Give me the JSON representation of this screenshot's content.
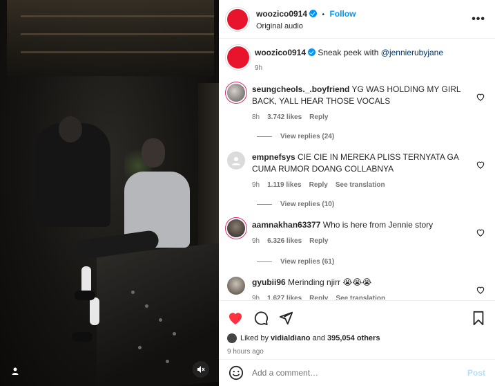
{
  "media": {
    "icons": {
      "user_tag": "person-icon",
      "mute": "speaker-muted-icon"
    }
  },
  "header": {
    "username": "woozico0914",
    "follow_label": "Follow",
    "dot": "•",
    "subtitle": "Original audio",
    "more": "•••",
    "avatar_color": "#e8142e"
  },
  "caption": {
    "username": "woozico0914",
    "text": "Sneak peek with ",
    "mention": "@jennierubyjane",
    "time": "9h"
  },
  "comments": [
    {
      "username": "seungcheols._.boyfriend",
      "text": "YG WAS HOLDING MY GIRL BACK, YALL HEAR THOSE VOCALS",
      "time": "8h",
      "likes": "3.742 likes",
      "reply": "Reply",
      "view_replies": "View replies (24)"
    },
    {
      "username": "empnefsys",
      "text": "CIE CIE IN MEREKA PLISS TERNYATA GA CUMA RUMOR DOANG COLLABNYA",
      "time": "9h",
      "likes": "1.119 likes",
      "reply": "Reply",
      "translate": "See translation",
      "view_replies": "View replies (10)"
    },
    {
      "username": "aamnakhan63377",
      "text": "Who is here from Jennie story",
      "time": "9h",
      "likes": "6.326 likes",
      "reply": "Reply",
      "view_replies": "View replies (61)"
    },
    {
      "username": "gyubii96",
      "text": "Merinding njirr 😭😭😭",
      "time": "9h",
      "likes": "1.627 likes",
      "reply": "Reply",
      "translate": "See translation"
    }
  ],
  "actions": {
    "liked_by_prefix": "Liked by ",
    "liked_by_user": "vidialdiano",
    "liked_by_suffix": " and ",
    "others": "395,054 others",
    "ago": "9 hours ago",
    "like_color": "#ff3040"
  },
  "add_comment": {
    "placeholder": "Add a comment…",
    "post_label": "Post"
  }
}
